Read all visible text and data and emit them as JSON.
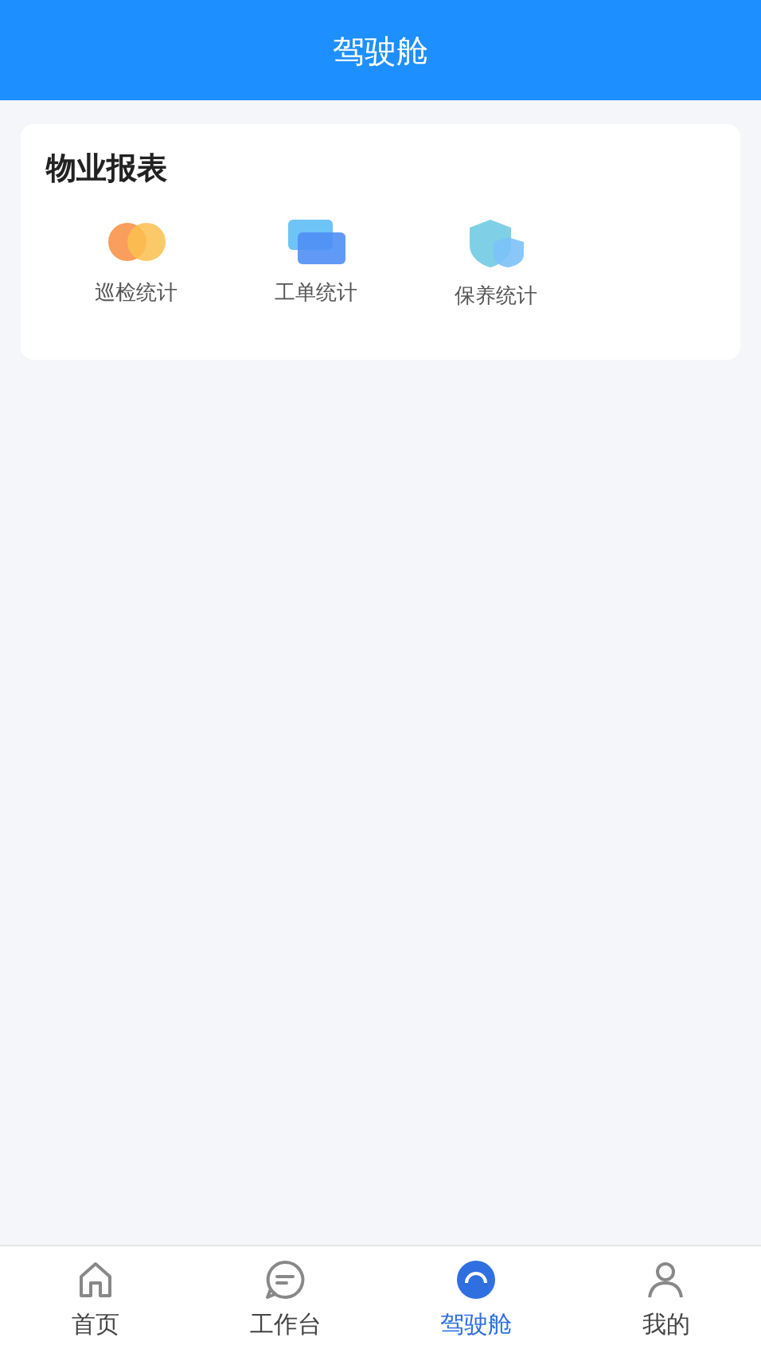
{
  "header": {
    "title": "驾驶舱"
  },
  "report_card": {
    "title": "物业报表",
    "items": [
      {
        "label": "巡检统计",
        "kind": "circles"
      },
      {
        "label": "工单统计",
        "kind": "cards"
      },
      {
        "label": "保养统计",
        "kind": "shields"
      }
    ]
  },
  "tab_bar": [
    {
      "label": "首页",
      "kind": "home",
      "selected": false
    },
    {
      "label": "工作台",
      "kind": "chat",
      "selected": false
    },
    {
      "label": "驾驶舱",
      "kind": "dial",
      "selected": true
    },
    {
      "label": "我的",
      "kind": "person",
      "selected": false
    }
  ]
}
